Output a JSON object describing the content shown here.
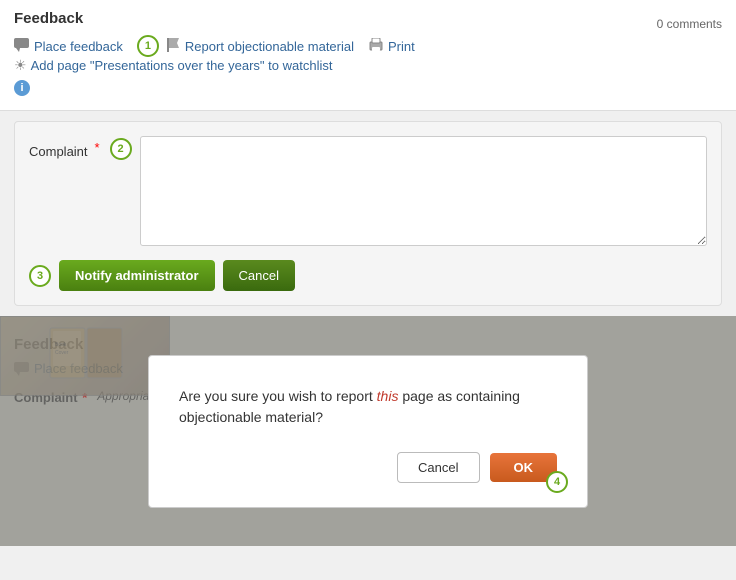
{
  "page": {
    "title": "Feedback",
    "comments_count": "0 comments"
  },
  "toolbar": {
    "step1_number": "1",
    "place_feedback_label": "Place feedback",
    "report_label": "Report objectionable material",
    "print_label": "Print",
    "watchlist_label": "Add page \"Presentations over the years\" to watchlist",
    "info_label": "i"
  },
  "form": {
    "step2_number": "2",
    "complaint_label": "Complaint",
    "complaint_placeholder": "",
    "step3_number": "3",
    "notify_button_label": "Notify administrator",
    "cancel_button_label": "Cancel"
  },
  "bottom": {
    "feedback_title": "Feedback",
    "place_feedback_label": "Place feedback",
    "complaint_label": "Complaint",
    "complaint_value": "Appropriate license information for the book cover is missing."
  },
  "modal": {
    "step4_number": "4",
    "message_part1": "Are you sure you wish to report ",
    "message_highlight": "this",
    "message_part2": " page as containing\nobjectionable material?",
    "cancel_label": "Cancel",
    "ok_label": "OK"
  }
}
